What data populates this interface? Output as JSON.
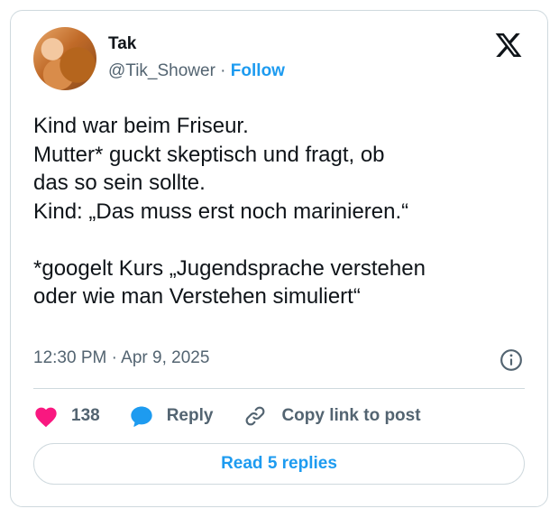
{
  "tweet": {
    "author_name": "Tak",
    "handle": "@Tik_Shower",
    "separator": " · ",
    "follow_label": "Follow",
    "text": "Kind war beim Friseur.\nMutter* guckt skeptisch und fragt, ob\ndas so sein sollte.\nKind: „Das muss erst noch marinieren.“\n\n*googelt Kurs „Jugendsprache verstehen\noder wie man Verstehen simuliert“",
    "time": "12:30 PM",
    "date": "Apr 9, 2025",
    "meta_separator": " · "
  },
  "actions": {
    "like_count": "138",
    "reply_label": "Reply",
    "copy_label": "Copy link to post"
  },
  "footer": {
    "read_replies_label": "Read 5 replies"
  },
  "icons": {
    "logo": "x-logo-icon",
    "info": "info-icon",
    "like": "heart-icon",
    "reply": "speech-bubble-icon",
    "copy": "link-icon"
  },
  "colors": {
    "accent": "#1d9bf0",
    "like": "#f91880",
    "secondary_text": "#536471",
    "border": "#cfd9de"
  }
}
